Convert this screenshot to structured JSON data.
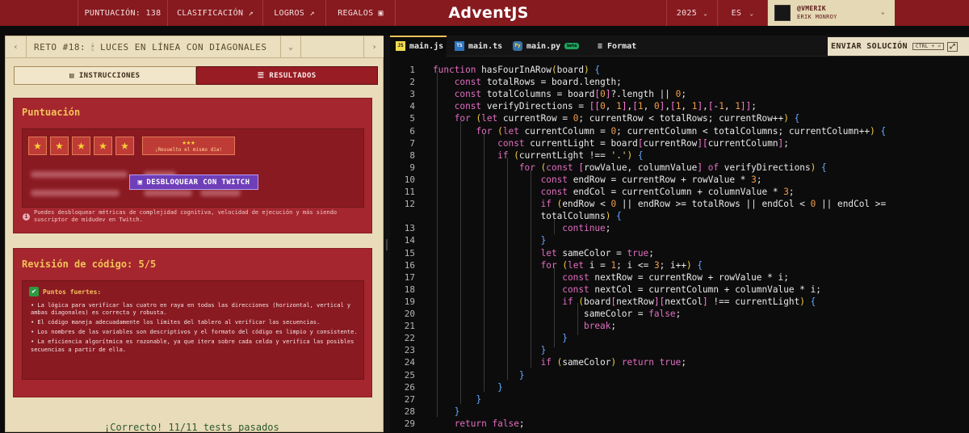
{
  "topbar": {
    "score": "PUNTUACIÓN: 138",
    "ranking": "CLASIFICACIÓN ↗",
    "achievements": "LOGROS ↗",
    "gifts": "REGALOS",
    "logo": "AdventJS",
    "year": "2025",
    "lang": "ES",
    "username": "@VMERIK",
    "fullname": "ERIK MONROY"
  },
  "challenge": {
    "title": "RETO #18: 🕯 LUCES EN LÍNEA CON DIAGONALES"
  },
  "tabs": {
    "instructions": "INSTRUCCIONES",
    "results": "RESULTADOS"
  },
  "score_card": {
    "title": "Puntuación",
    "badge_stars": "★★★",
    "badge_text": "¡Resuelto el mismo día!",
    "twitch_button": "DESBLOQUEAR CON TWITCH",
    "note": "Puedes desbloquear métricas de complejidad cognitiva, velocidad de ejecución y más siendo suscriptor de midudev en Twitch.",
    "stars": 5
  },
  "review_card": {
    "title": "Revisión de código: 5/5",
    "strengths_title": "Puntos fuertes:",
    "bullets": [
      "• La lógica para verificar las cuatro en raya en todas las direcciones (horizontal, vertical y ambas diagonales) es correcta y robusta.",
      "• El código maneja adecuadamente los límites del tablero al verificar las secuencias.",
      "• Los nombres de las variables son descriptivos y el formato del código es limpio y consistente.",
      "• La eficiencia algorítmica es razonable, ya que itera sobre cada celda y verifica las posibles secuencias a partir de ella."
    ]
  },
  "result": "¡Correcto! 11/11 tests pasados",
  "editor": {
    "tabs": [
      "main.js",
      "main.ts",
      "main.py",
      "Format"
    ],
    "beta": "beta",
    "submit": "ENVIAR SOLUCIÓN",
    "shortcut": "CTRL + ⏎"
  },
  "code": [
    {
      "n": "1",
      "t": "function hasFourInARow(board) {"
    },
    {
      "n": "2",
      "t": "    const totalRows = board.length;"
    },
    {
      "n": "3",
      "t": "    const totalColumns = board[0]?.length || 0;"
    },
    {
      "n": "4",
      "t": "    const verifyDirections = [[0, 1],[1, 0],[1, 1],[-1, 1]];"
    },
    {
      "n": "5",
      "t": "    for (let currentRow = 0; currentRow < totalRows; currentRow++) {"
    },
    {
      "n": "6",
      "t": "        for (let currentColumn = 0; currentColumn < totalColumns; currentColumn++) {"
    },
    {
      "n": "7",
      "t": "            const currentLight = board[currentRow][currentColumn];"
    },
    {
      "n": "8",
      "t": "            if (currentLight !== '.') {"
    },
    {
      "n": "9",
      "t": "                for (const [rowValue, columnValue] of verifyDirections) {"
    },
    {
      "n": "10",
      "t": "                    const endRow = currentRow + rowValue * 3;"
    },
    {
      "n": "11",
      "t": "                    const endCol = currentColumn + columnValue * 3;"
    },
    {
      "n": "12",
      "t": "                    if (endRow < 0 || endRow >= totalRows || endCol < 0 || endCol >="
    },
    {
      "n": "",
      "t": "                    totalColumns) {"
    },
    {
      "n": "13",
      "t": "                        continue;"
    },
    {
      "n": "14",
      "t": "                    }"
    },
    {
      "n": "15",
      "t": "                    let sameColor = true;"
    },
    {
      "n": "16",
      "t": "                    for (let i = 1; i <= 3; i++) {"
    },
    {
      "n": "17",
      "t": "                        const nextRow = currentRow + rowValue * i;"
    },
    {
      "n": "18",
      "t": "                        const nextCol = currentColumn + columnValue * i;"
    },
    {
      "n": "19",
      "t": "                        if (board[nextRow][nextCol] !== currentLight) {"
    },
    {
      "n": "20",
      "t": "                            sameColor = false;"
    },
    {
      "n": "21",
      "t": "                            break;"
    },
    {
      "n": "22",
      "t": "                        }"
    },
    {
      "n": "23",
      "t": "                    }"
    },
    {
      "n": "24",
      "t": "                    if (sameColor) return true;"
    },
    {
      "n": "25",
      "t": "                }"
    },
    {
      "n": "26",
      "t": "            }"
    },
    {
      "n": "27",
      "t": "        }"
    },
    {
      "n": "28",
      "t": "    }"
    },
    {
      "n": "29",
      "t": "    return false;"
    }
  ]
}
